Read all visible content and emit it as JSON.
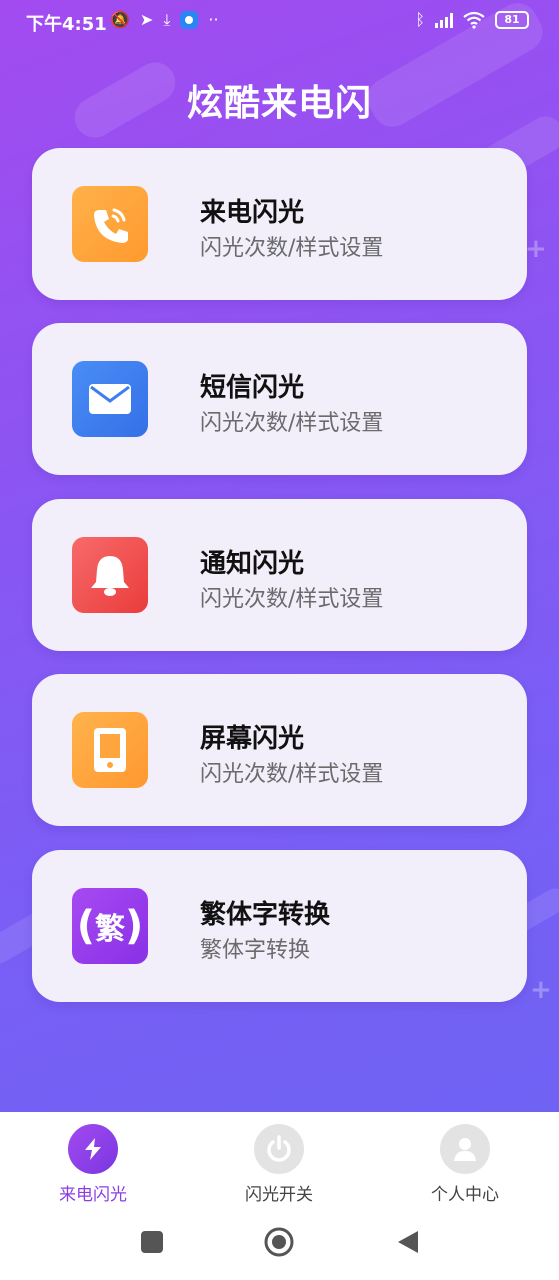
{
  "status_bar": {
    "time": "下午4:51",
    "battery": "81"
  },
  "page": {
    "title": "炫酷来电闪"
  },
  "cards": [
    {
      "name": "来电闪光",
      "desc": "闪光次数/样式设置",
      "icon": "phone-ringing-icon",
      "color": "#ffa53d"
    },
    {
      "name": "短信闪光",
      "desc": "闪光次数/样式设置",
      "icon": "mail-icon",
      "color": "#3f7ef0"
    },
    {
      "name": "通知闪光",
      "desc": "闪光次数/样式设置",
      "icon": "bell-icon",
      "color": "#f04848"
    },
    {
      "name": "屏幕闪光",
      "desc": "闪光次数/样式设置",
      "icon": "phone-screen-icon",
      "color": "#ffa53d"
    },
    {
      "name": "繁体字转换",
      "desc": "繁体字转换",
      "icon": "traditional-char-icon",
      "icon_char": "繁",
      "color": "#9b3ff0"
    }
  ],
  "bottom_nav": {
    "items": [
      {
        "label": "来电闪光",
        "icon": "lightning-icon",
        "active": true
      },
      {
        "label": "闪光开关",
        "icon": "power-icon",
        "active": false
      },
      {
        "label": "个人中心",
        "icon": "user-icon",
        "active": false
      }
    ]
  },
  "colors": {
    "accent": "#8a3fe6",
    "gradient_start": "#a24bf0",
    "gradient_end": "#6f63f4",
    "card_bg": "#f2effb"
  }
}
